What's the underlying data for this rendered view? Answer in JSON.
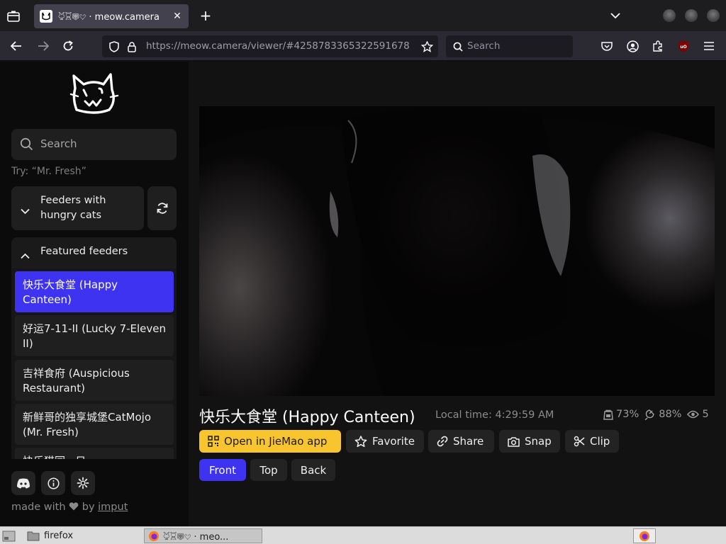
{
  "browser": {
    "tab_title": "𔘐𔘑𔘒𔘓 · meow.camera",
    "url_base": "https://meow.camera",
    "url_path": "/viewer/#4258783365322591678",
    "search_placeholder": "Search"
  },
  "sidebar": {
    "search_placeholder": "Search",
    "try_hint": "Try: “Mr. Fresh”",
    "feeders_hungry_label": "Feeders with hungry cats",
    "featured_label": "Featured feeders",
    "feeders": [
      {
        "name": "快乐大食堂 (Happy Canteen)",
        "active": true
      },
      {
        "name": "好运7-11-II (Lucky 7-Eleven II)",
        "active": false
      },
      {
        "name": "吉祥食府 (Auspicious Restaurant)",
        "active": false
      },
      {
        "name": "新鲜哥的独享城堡CatMojo (Mr. Fresh)",
        "active": false
      },
      {
        "name": "快乐猫园 · 日",
        "active": false
      }
    ],
    "footer_made_with": "made with",
    "footer_by": "by",
    "footer_author": "imput"
  },
  "viewer": {
    "title": "快乐大食堂 (Happy Canteen)",
    "local_time": "Local time: 4:29:59 AM",
    "stats": {
      "food": "73%",
      "battery": "88%",
      "viewers": "5"
    },
    "actions": {
      "open_app": "Open in JieMao app",
      "favorite": "Favorite",
      "share": "Share",
      "snap": "Snap",
      "clip": "Clip"
    },
    "views": {
      "front": "Front",
      "top": "Top",
      "back": "Back",
      "selected": "Front"
    }
  },
  "taskbar": {
    "folder_label": "firefox",
    "window_label": "𔘐𔘑𔘒𔘓 · meo..."
  },
  "colors": {
    "accent": "#3d33f0",
    "app_button": "#f8c52f"
  }
}
